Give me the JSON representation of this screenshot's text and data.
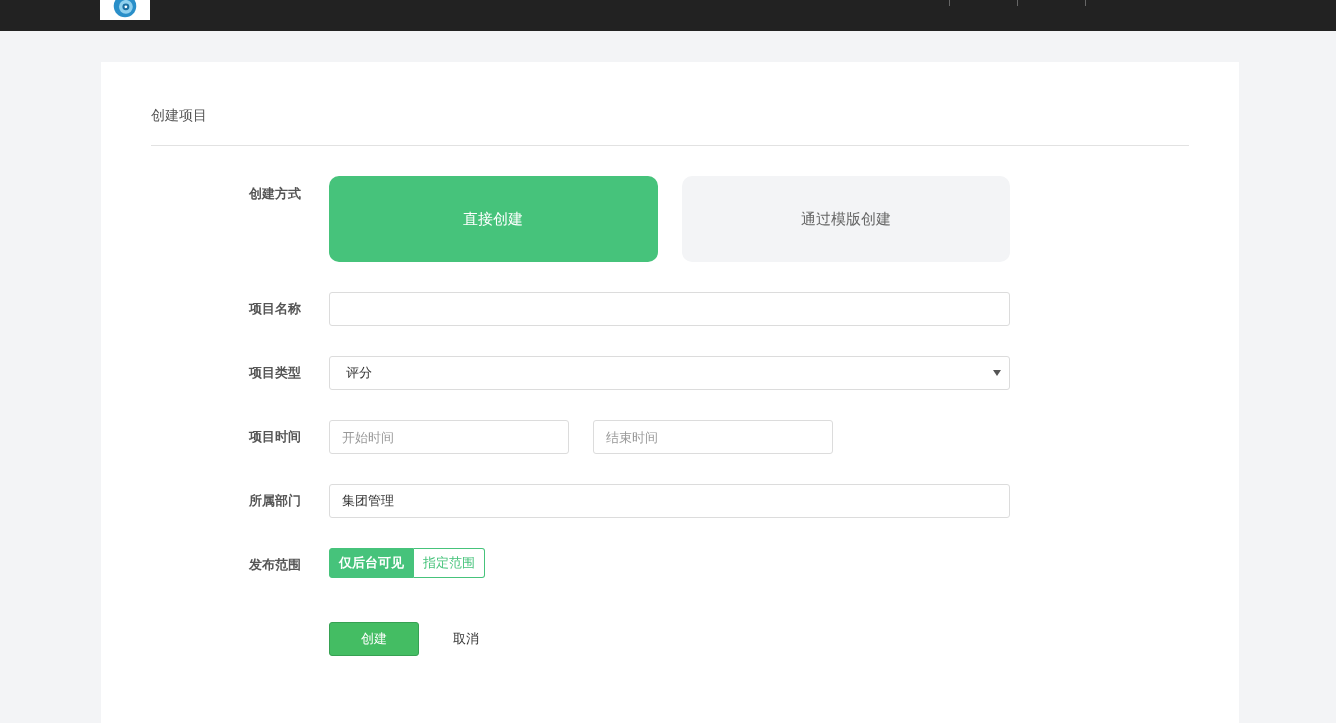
{
  "page_title": "创建项目",
  "form": [
    {
      "kind": "choice_cards",
      "label": "创建方式",
      "options": [
        {
          "label": "直接创建",
          "selected": true
        },
        {
          "label": "通过模版创建",
          "selected": false
        }
      ]
    },
    {
      "kind": "text",
      "label": "项目名称"
    },
    {
      "kind": "select",
      "label": "项目类型",
      "value": "评分"
    },
    {
      "kind": "range",
      "label": "项目时间",
      "fields": [
        {
          "placeholder": "开始时间"
        },
        {
          "placeholder": "结束时间"
        }
      ]
    },
    {
      "kind": "text",
      "label": "所属部门",
      "value": "集团管理"
    },
    {
      "kind": "segmented",
      "label": "发布范围",
      "options": [
        {
          "label": "仅后台可见",
          "selected": true
        },
        {
          "label": "指定范围",
          "selected": false
        }
      ]
    }
  ],
  "actions": [
    {
      "label": "创建",
      "kind": "primary"
    },
    {
      "label": "取消",
      "kind": "link"
    }
  ]
}
